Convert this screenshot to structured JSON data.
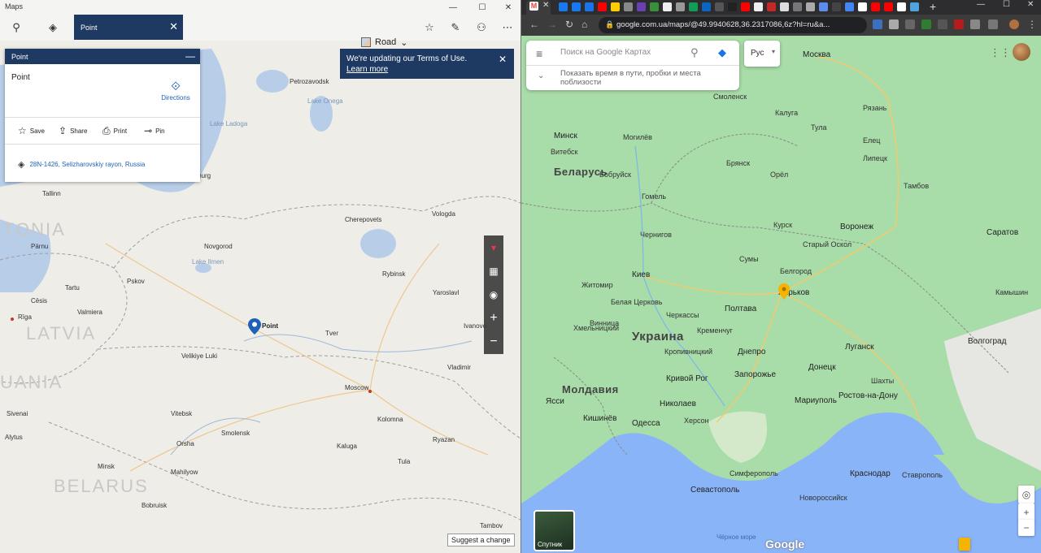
{
  "windows_maps": {
    "app_title": "Maps",
    "tab_label": "Point",
    "map_style_label": "Road",
    "panel": {
      "header": "Point",
      "title": "Point",
      "directions_label": "Directions",
      "actions": [
        "Save",
        "Share",
        "Print",
        "Pin"
      ],
      "address": "28N-1426, Selizharovskiy rayon, Russia"
    },
    "terms_banner": {
      "text": "We're updating our Terms of Use.",
      "link": "Learn more"
    },
    "pin_label": "Point",
    "suggest_label": "Suggest a change",
    "map_labels": {
      "countries": [
        "TONIA",
        "LATVIA",
        "UANIA",
        "BELARUS"
      ],
      "cities": [
        "Petrozavodsk",
        "Lake Onega",
        "Lake Ladoga",
        "ersburg",
        "Tallinn",
        "Cherepovets",
        "Vologda",
        "Novgorod",
        "Lake Ilmen",
        "Rybinsk",
        "Pskov",
        "Yaroslavl",
        "Pärnu",
        "Tartu",
        "Valmiera",
        "Cēsis",
        "Rīga",
        "Velikiye Luki",
        "Tver",
        "Ivanovo",
        "Vladimir",
        "Moscow",
        "Kolomna",
        "Vitebsk",
        "Smolensk",
        "Kaluga",
        "Tula",
        "Ryazan",
        "Orsha",
        "Minsk",
        "Mahilyow",
        "Bobruisk",
        "Tambov",
        "Alytus",
        "Sivenai"
      ]
    }
  },
  "chrome": {
    "url": "google.com.ua/maps/@49.9940628,36.2317086,6z?hl=ru&a...",
    "search_placeholder": "Поиск на Google Картах",
    "traffic_text": "Показать время в пути, пробки и места поблизости",
    "layer_button": "Рус",
    "satellite_label": "Спутник",
    "google_logo": "Google",
    "map_labels": {
      "countries": [
        "Беларусь",
        "Украина",
        "Молдавия"
      ],
      "cities": [
        "Москва",
        "Минск",
        "Могилёв",
        "Гомель",
        "Брянск",
        "Курск",
        "Воронеж",
        "Киев",
        "Житомир",
        "Белая Церковь",
        "Винница",
        "Черкассы",
        "Полтава",
        "Харьков",
        "Сумы",
        "Белгород",
        "Кременчуг",
        "Кропивницкий",
        "Днепро",
        "Кривой Рог",
        "Запорожье",
        "Донецк",
        "Луганск",
        "Хмельницкий",
        "Ясси",
        "Кишинёв",
        "Николаев",
        "Одесса",
        "Херсон",
        "Мариуполь",
        "Ростов-на-Дону",
        "Краснодар",
        "Ставрополь",
        "Волгоград",
        "Саратов",
        "Тамбов",
        "Липецк",
        "Орёл",
        "Калуга",
        "Тула",
        "Рязань",
        "Новороссийск",
        "Севастополь",
        "Симферополь",
        "Старый Оскол",
        "Елец",
        "Шахты",
        "Камышин",
        "Чернигов",
        "Бобруйск",
        "Витебск",
        "Смоленск"
      ],
      "sea": "Чёрное море"
    }
  }
}
